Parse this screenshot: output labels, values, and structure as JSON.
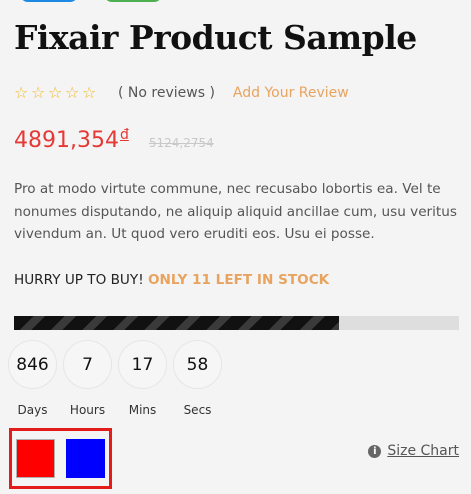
{
  "product": {
    "title": "Fixair Product Sample",
    "reviews_text": "( No reviews )",
    "add_review_label": "Add Your Review",
    "rating": 0,
    "rating_max": 5,
    "price": "4891,354",
    "currency": "đ",
    "old_price": "5124,2754",
    "description": "Pro at modo virtute commune, nec recusabo lobortis ea. Vel te nonumes disputando, ne aliquip aliquid ancillae cum, usu veritus vivendum an. Ut quod vero eruditi eos. Usu ei posse.",
    "stock_prefix": "HURRY UP TO BUY!",
    "stock_left": "ONLY 11 LEFT IN STOCK",
    "stock_progress_percent": 73
  },
  "countdown": [
    {
      "value": "846",
      "label": "Days"
    },
    {
      "value": "7",
      "label": "Hours"
    },
    {
      "value": "17",
      "label": "Mins"
    },
    {
      "value": "58",
      "label": "Secs"
    }
  ],
  "swatches": [
    {
      "name": "red",
      "color": "#ff0000"
    },
    {
      "name": "blue",
      "color": "#0000ff"
    }
  ],
  "size_chart_label": "Size Chart",
  "colors": {
    "price": "#e53935",
    "accent": "#e8a35f",
    "star": "#f5b921",
    "highlight_border": "#e31b1b"
  }
}
